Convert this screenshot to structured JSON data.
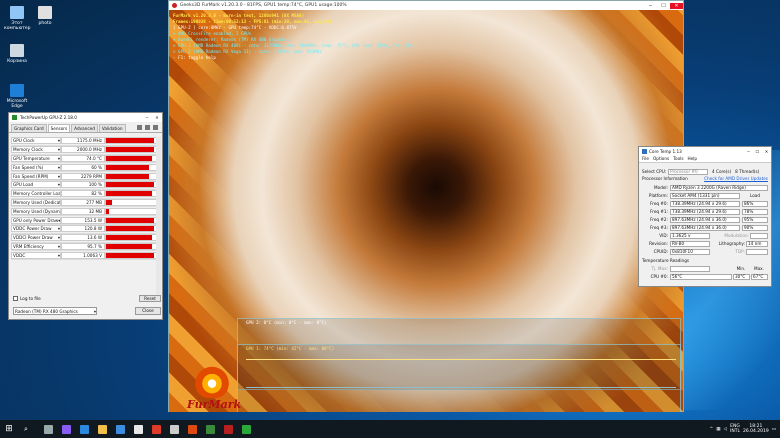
{
  "desktop": {
    "icons": [
      {
        "label": "Этот компьютер",
        "color": "#8fc6f5"
      },
      {
        "label": "photo",
        "color": "#e0e0e0"
      },
      {
        "label": "Корзина",
        "color": "#cfd8e0"
      },
      {
        "label": "Microsoft Edge",
        "color": "#1e7fd6"
      }
    ]
  },
  "furmark": {
    "title": "Geeks3D FurMark v1.20.3.0 - 81FPS, GPU1 temp:74°C, GPU1 usage:100%",
    "info": [
      {
        "text": "FurMark v1.20.3.0 - Burn-in test, 1280x941 (8X MSAA)",
        "cls": "y"
      },
      {
        "text": "Frames:198038 - time:00:52:13 - FPS:81 (min:29, max:81, avg:80)",
        "cls": "y"
      },
      {
        "text": "[ GPU-Z ] core:0MHz - GPU temp:74°C - VDDC:0.875V",
        "cls": "w"
      },
      {
        "text": "> AMD CrossFire enabled, 2 GPUs",
        "cls": "c"
      },
      {
        "text": "> OpenGL renderer: Radeon (TM) RX 480 Graphics",
        "cls": "c"
      },
      {
        "text": "> GPU 1 (AMD Radeon RX 480) - core: 1175MHz, mem: 2000MHz, temp: 75°C, GPU load: 100%, fan: 60%",
        "cls": "c"
      },
      {
        "text": "> GPU 2 (AMD Radeon RX Vega 11) - core: 320MHz, mem: 933MHz",
        "cls": "c"
      },
      {
        "text": "- F1: toggle help",
        "cls": "w"
      }
    ],
    "monitor_gpu2": "GPU 2: 0°C (min: 0°C - max: 0°C)",
    "monitor_gpu1": "GPU 1: 74°C (min: 42°C - max: 80°C)",
    "logo": "FurMark",
    "colors": {
      "gpu1_line": "#ffe080",
      "gpu2_line": "#a0d8e8"
    }
  },
  "gpuz": {
    "title": "TechPowerUp GPU-Z 2.18.0",
    "tabs": [
      "Graphics Card",
      "Sensors",
      "Advanced",
      "Validation"
    ],
    "active_tab": 1,
    "sensors": [
      {
        "name": "GPU Clock",
        "value": "1175.0 MHz",
        "fill": 0.95
      },
      {
        "name": "Memory Clock",
        "value": "2000.0 MHz",
        "fill": 0.95
      },
      {
        "name": "GPU Temperature",
        "value": "74.0 °C",
        "fill": 0.9
      },
      {
        "name": "Fan Speed (%)",
        "value": "60 %",
        "fill": 0.85
      },
      {
        "name": "Fan Speed (RPM)",
        "value": "2279 RPM",
        "fill": 0.85
      },
      {
        "name": "GPU Load",
        "value": "100 %",
        "fill": 0.95
      },
      {
        "name": "Memory Controller Load",
        "value": "82 %",
        "fill": 0.9
      },
      {
        "name": "Memory Used (Dedicated)",
        "value": "277 MB",
        "fill": 0.12
      },
      {
        "name": "Memory Used (Dynamic)",
        "value": "32 MB",
        "fill": 0.05
      },
      {
        "name": "GPU only Power Draw",
        "value": "153.5 W",
        "fill": 0.95
      },
      {
        "name": "VDDC Power Draw",
        "value": "120.8 W",
        "fill": 0.95
      },
      {
        "name": "VDDCI Power Draw",
        "value": "13.6 W",
        "fill": 0.9
      },
      {
        "name": "VRM Efficiency",
        "value": "95.7 %",
        "fill": 0.9
      },
      {
        "name": "VDDC",
        "value": "1.0063 V",
        "fill": 0.95
      }
    ],
    "log_label": "Log to file",
    "reset_label": "Reset",
    "gpu_select": "Radeon (TM) RX 480 Graphics",
    "close_label": "Close"
  },
  "coretemp": {
    "title": "Core Temp 1.13",
    "menu": [
      "File",
      "Options",
      "Tools",
      "Help"
    ],
    "select_cpu_label": "Select CPU:",
    "select_cpu_value": "Processor #0",
    "cores": "4",
    "cores_label": "Core(s)",
    "threads": "8",
    "threads_label": "Thread(s)",
    "proc_info_label": "Processor Information",
    "check_updates": "Check for AMD Driver Updates",
    "model_label": "Model:",
    "model": "AMD Ryzen 3 2200G (Raven Ridge)",
    "platform_label": "Platform:",
    "platform": "Socket AM4 (1331 pin)",
    "load_label": "Load",
    "freqs": [
      {
        "label": "Freq #0:",
        "value": "738.39MHz (24.94 x 29.6)",
        "load": "86%"
      },
      {
        "label": "Freq #1:",
        "value": "738.39MHz (24.94 x 29.6)",
        "load": "78%"
      },
      {
        "label": "Freq #2:",
        "value": "897.63MHz (24.94 x 36.0)",
        "load": "95%"
      },
      {
        "label": "Freq #3:",
        "value": "897.63MHz (24.94 x 36.0)",
        "load": "90%"
      }
    ],
    "vid_label": "VID:",
    "vid": "1.3625 v",
    "modulation_label": "Modulation:",
    "revision_label": "Revision:",
    "revision": "RV-B0",
    "lithography_label": "Lithography:",
    "lithography": "14 nm",
    "cpuid_label": "CPUID:",
    "cpuid": "0x810F10",
    "tdp_label": "TDP:",
    "temp_label": "Temperature Readings",
    "tjmax_label": "Tj. Max:",
    "min_label": "Min.",
    "max_label": "Max.",
    "cpu_label": "CPU #0:",
    "cpu_temp": "56°C",
    "cpu_min": "30°C",
    "cpu_max": "67°C"
  },
  "taskbar": {
    "apps": [
      {
        "name": "task-view",
        "color": "#9aa"
      },
      {
        "name": "cortana",
        "color": "#8a5cf6"
      },
      {
        "name": "edge",
        "color": "#2b8ae0"
      },
      {
        "name": "explorer",
        "color": "#f2c04a"
      },
      {
        "name": "store",
        "color": "#3b8de0"
      },
      {
        "name": "mail",
        "color": "#e8e8e8"
      },
      {
        "name": "yandex",
        "color": "#e03a2a"
      },
      {
        "name": "settings",
        "color": "#ccc"
      },
      {
        "name": "furmark",
        "color": "#e04a10"
      },
      {
        "name": "gpuz",
        "color": "#3a8a3a"
      },
      {
        "name": "coretemp",
        "color": "#b82020"
      },
      {
        "name": "monitor",
        "color": "#2aa83a"
      }
    ],
    "lang": "ENG",
    "lang2": "INTL",
    "time": "18:21",
    "date": "26.04.2019"
  }
}
